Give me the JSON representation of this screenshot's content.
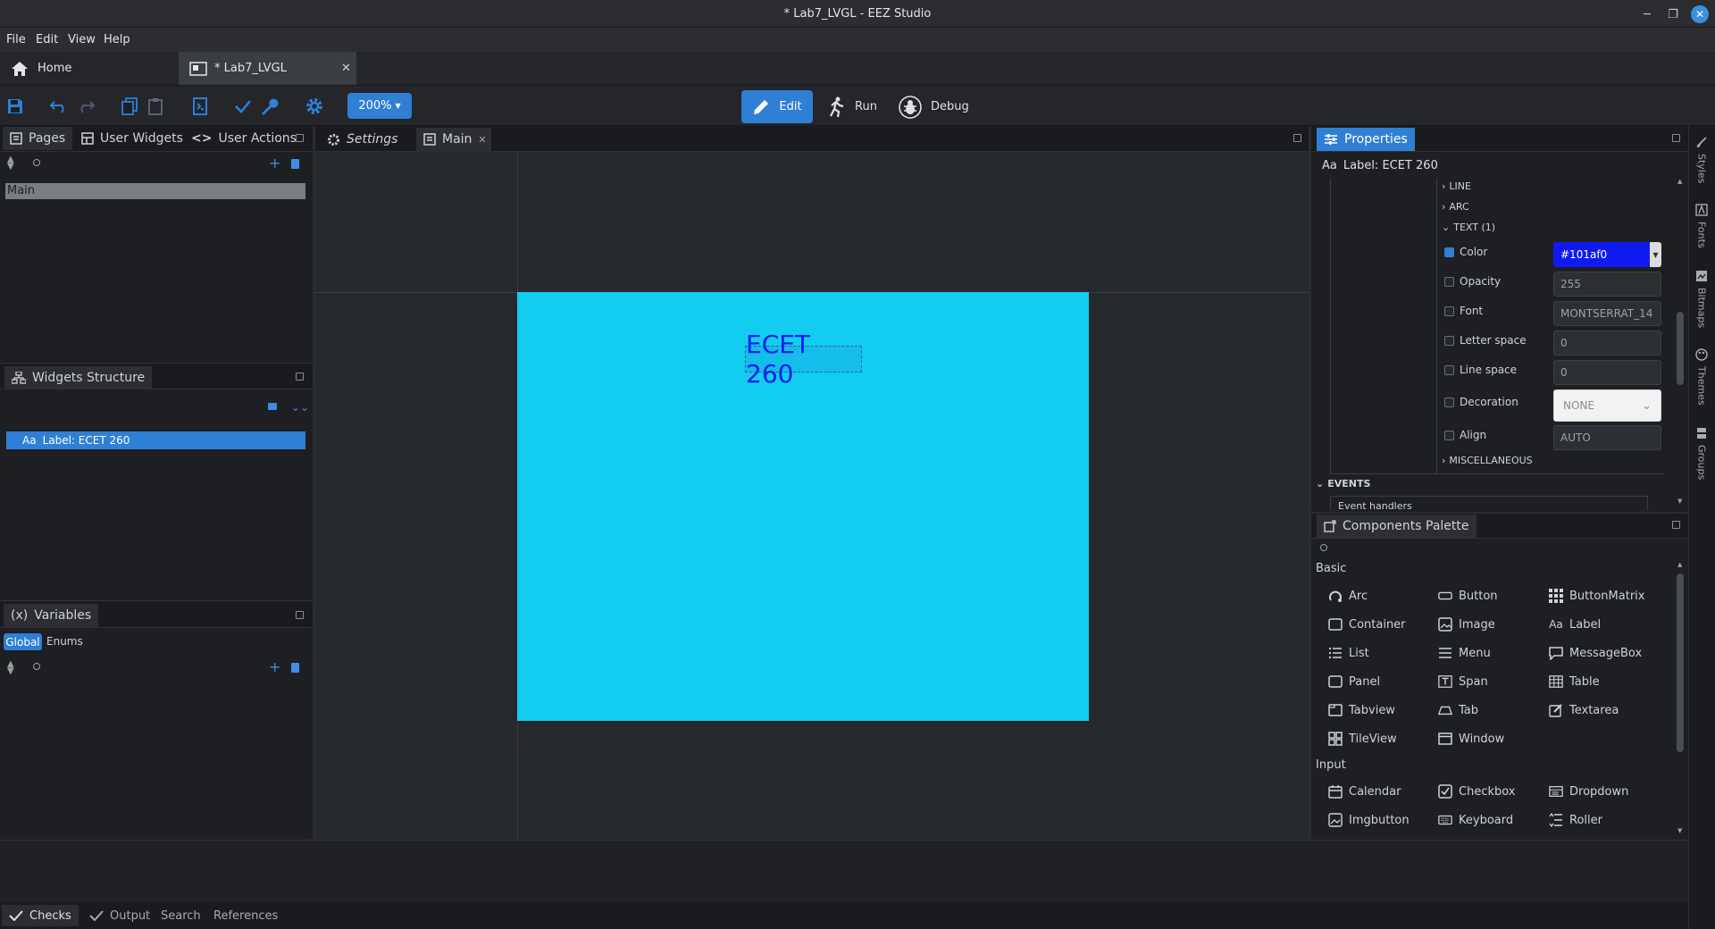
{
  "window": {
    "title": "* Lab7_LVGL - EEZ Studio"
  },
  "menu": [
    "File",
    "Edit",
    "View",
    "Help"
  ],
  "tabs": {
    "home": "Home",
    "project": "* Lab7_LVGL"
  },
  "toolbar": {
    "zoom": "200%",
    "modes": {
      "edit": "Edit",
      "run": "Run",
      "debug": "Debug"
    }
  },
  "left": {
    "pages": {
      "tabs": [
        "Pages",
        "User Widgets",
        "User Actions"
      ],
      "items": [
        "Main"
      ]
    },
    "widgets": {
      "title": "Widgets Structure",
      "items": [
        "Label: ECET 260"
      ]
    },
    "variables": {
      "title": "Variables",
      "prefix": "(x)",
      "tabs": [
        "Global",
        "Enums"
      ]
    }
  },
  "editor": {
    "tabs": [
      "Settings",
      "Main"
    ],
    "label_text": "ECET 260",
    "label_color": "#101af0",
    "screen_color": "#12cdef"
  },
  "properties": {
    "title": "Properties",
    "selected": "Label: ECET 260",
    "sections": [
      "LINE",
      "ARC",
      "TEXT (1)",
      "MISCELLANEOUS"
    ],
    "rows": [
      {
        "label": "Color",
        "checked": true,
        "value": "#101af0"
      },
      {
        "label": "Opacity",
        "checked": false,
        "value": "255"
      },
      {
        "label": "Font",
        "checked": false,
        "value": "MONTSERRAT_14"
      },
      {
        "label": "Letter space",
        "checked": false,
        "value": "0"
      },
      {
        "label": "Line space",
        "checked": false,
        "value": "0"
      },
      {
        "label": "Decoration",
        "checked": false,
        "value": "NONE"
      },
      {
        "label": "Align",
        "checked": false,
        "value": "AUTO"
      }
    ],
    "events": {
      "title": "EVENTS",
      "handlers": "Event handlers"
    }
  },
  "palette": {
    "title": "Components Palette",
    "groups": [
      {
        "name": "Basic",
        "items": [
          "Arc",
          "Button",
          "ButtonMatrix",
          "Container",
          "Image",
          "Label",
          "List",
          "Menu",
          "MessageBox",
          "Panel",
          "Span",
          "Table",
          "Tabview",
          "Tab",
          "Textarea",
          "TileView",
          "Window"
        ]
      },
      {
        "name": "Input",
        "items": [
          "Calendar",
          "Checkbox",
          "Dropdown",
          "Imgbutton",
          "Keyboard",
          "Roller"
        ]
      }
    ]
  },
  "rail": [
    "Styles",
    "Fonts",
    "Bitmaps",
    "Themes",
    "Groups"
  ],
  "bottom_tabs": [
    "Checks",
    "Output",
    "Search",
    "References"
  ]
}
